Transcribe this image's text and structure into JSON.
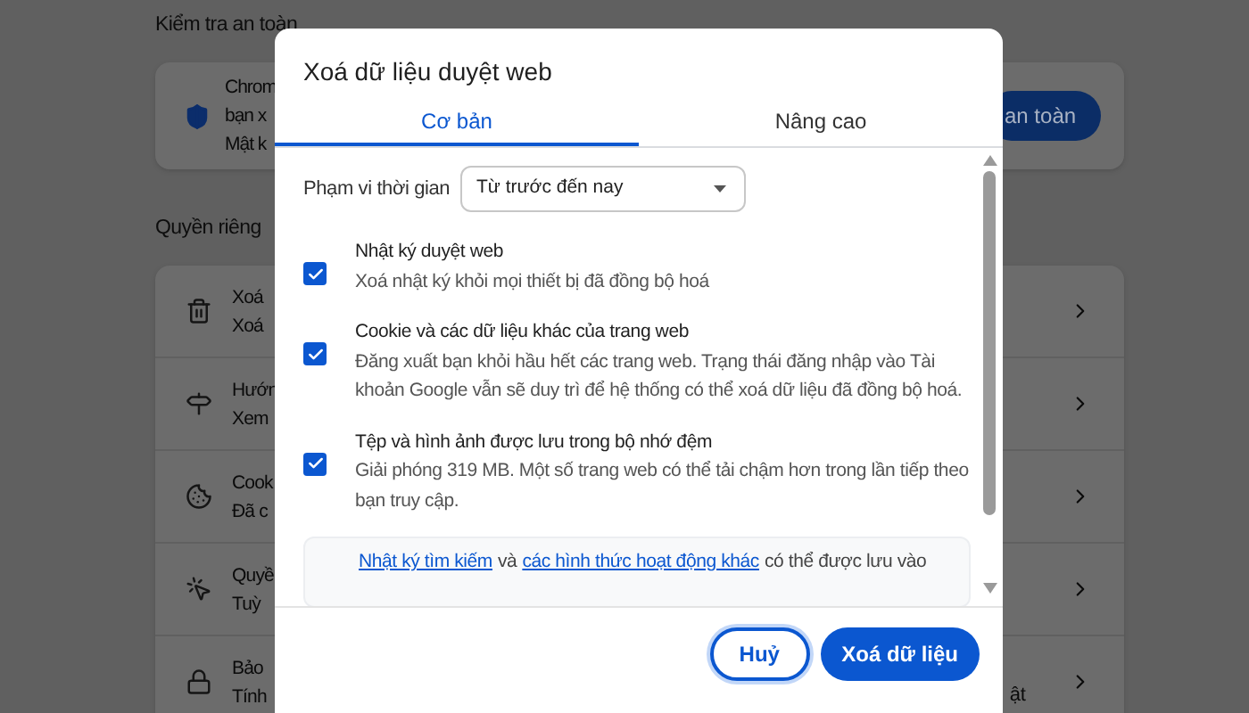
{
  "background": {
    "safety_title": "Kiểm tra an toàn",
    "safety_card": {
      "lines": [
        "Chrom",
        "bạn x",
        "Mật k"
      ],
      "button": "an toàn"
    },
    "privacy_title": "Quyền riêng",
    "rows": [
      {
        "title": "Xoá",
        "subtitle": "Xoá"
      },
      {
        "title": "Hướn",
        "subtitle": "Xem"
      },
      {
        "title": "Cook",
        "subtitle": "Đã c"
      },
      {
        "title": "Quyề",
        "subtitle": "Tuỳ"
      },
      {
        "title": "Bảo",
        "subtitle": "Tính",
        "tail": "ật"
      }
    ]
  },
  "dialog": {
    "title": "Xoá dữ liệu duyệt web",
    "tabs": [
      {
        "label": "Cơ bản",
        "selected": true
      },
      {
        "label": "Nâng cao",
        "selected": false
      }
    ],
    "time_range": {
      "label": "Phạm vi thời gian",
      "value": "Từ trước đến nay"
    },
    "options": [
      {
        "title": "Nhật ký duyệt web",
        "description": "Xoá nhật ký khỏi mọi thiết bị đã đồng bộ hoá",
        "checked": true
      },
      {
        "title": "Cookie và các dữ liệu khác của trang web",
        "description": "Đăng xuất bạn khỏi hầu hết các trang web. Trạng thái đăng nhập vào Tài khoản Google vẫn sẽ duy trì để hệ thống có thể xoá dữ liệu đã đồng bộ hoá.",
        "checked": true
      },
      {
        "title": "Tệp và hình ảnh được lưu trong bộ nhớ đệm",
        "description": "Giải phóng 319 MB. Một số trang web có thể tải chậm hơn trong lần tiếp theo bạn truy cập.",
        "checked": true
      }
    ],
    "note": [
      {
        "kind": "link",
        "text": "Nhật ký tìm kiếm"
      },
      {
        "kind": "text",
        "text": "và"
      },
      {
        "kind": "link",
        "text": "các hình thức hoạt động khác"
      },
      {
        "kind": "text",
        "text": "có thể được lưu vào"
      }
    ],
    "buttons": [
      {
        "kind": "secondary",
        "label": "Huỷ"
      },
      {
        "kind": "primary",
        "label": "Xoá dữ liệu"
      }
    ]
  }
}
